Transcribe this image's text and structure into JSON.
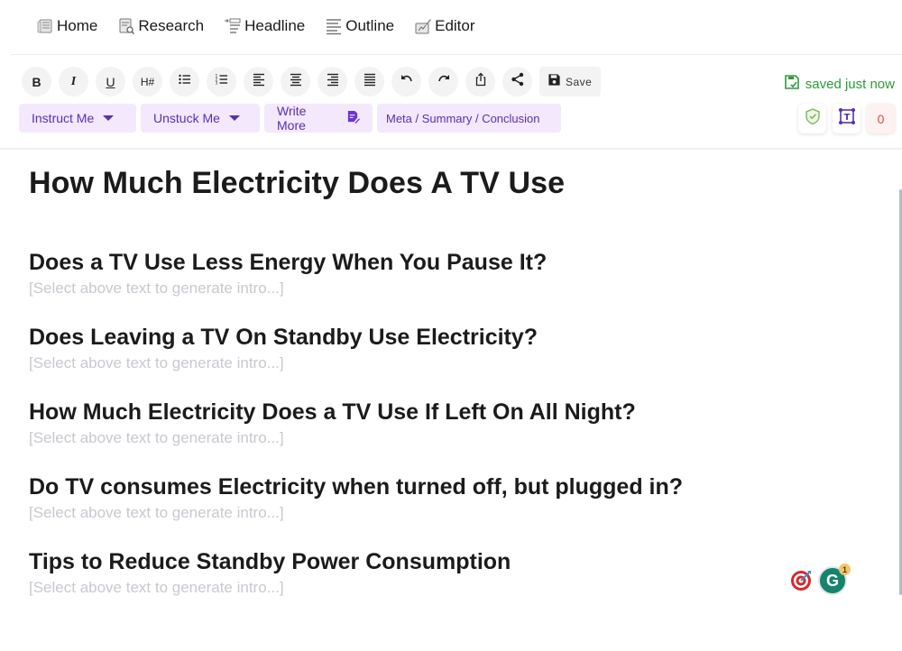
{
  "nav": {
    "items": [
      {
        "label": "Home",
        "icon": "home-newspaper-icon"
      },
      {
        "label": "Research",
        "icon": "research-icon"
      },
      {
        "label": "Headline",
        "icon": "headline-icon"
      },
      {
        "label": "Outline",
        "icon": "outline-icon"
      },
      {
        "label": "Editor",
        "icon": "editor-icon"
      }
    ]
  },
  "toolbar": {
    "bold": "B",
    "italic": "I",
    "underline": "U",
    "heading": "H#",
    "save_label": "Save"
  },
  "ai_buttons": {
    "instruct": "Instruct Me",
    "unstuck": "Unstuck Me",
    "write_more": "Write More",
    "meta": "Meta / Summary / Conclusion"
  },
  "status": {
    "saved_text": "saved just now",
    "issue_count": "0",
    "grammarly_badge": "1",
    "colors": {
      "saved": "#2e9a3a",
      "accent": "#5a2fb3",
      "ai_bg": "#f3e8fc",
      "error": "#e04a4a"
    }
  },
  "document": {
    "title": "How Much Electricity Does A TV Use",
    "sections": [
      {
        "heading": "Does a TV Use Less Energy When You Pause It?",
        "placeholder": "[Select above text to generate intro...]"
      },
      {
        "heading": "Does Leaving a TV On Standby Use Electricity?",
        "placeholder": "[Select above text to generate intro...]"
      },
      {
        "heading": "How Much Electricity Does a TV Use If Left On All Night?",
        "placeholder": "[Select above text to generate intro...]"
      },
      {
        "heading": "Do TV consumes Electricity when turned off, but plugged in?",
        "placeholder": "[Select above text to generate intro...]"
      },
      {
        "heading": "Tips to Reduce Standby Power Consumption",
        "placeholder": "[Select above text to generate intro...]"
      }
    ]
  }
}
